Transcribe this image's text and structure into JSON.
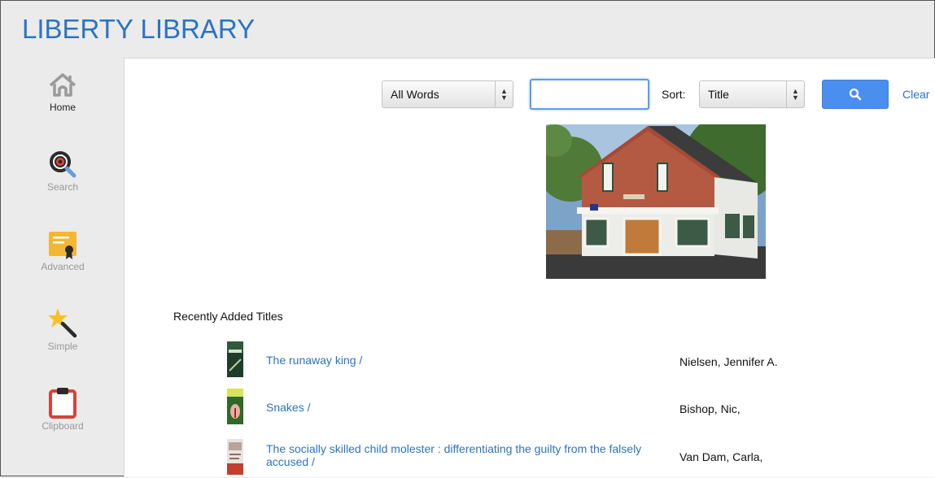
{
  "app": {
    "title": "LIBERTY LIBRARY"
  },
  "sidebar": {
    "items": [
      {
        "label": "Home",
        "icon": "home-icon",
        "active": true
      },
      {
        "label": "Search",
        "icon": "search-target-icon",
        "active": false
      },
      {
        "label": "Advanced",
        "icon": "certificate-icon",
        "active": false
      },
      {
        "label": "Simple",
        "icon": "magic-wand-icon",
        "active": false
      },
      {
        "label": "Clipboard",
        "icon": "clipboard-icon",
        "active": false
      }
    ]
  },
  "search": {
    "mode_value": "All Words",
    "query_value": "",
    "sort_label": "Sort:",
    "sort_value": "Title",
    "clear_label": "Clear",
    "button_icon": "magnifier-icon"
  },
  "recent": {
    "heading": "Recently Added Titles",
    "items": [
      {
        "title": "The runaway king /",
        "author": "Nielsen, Jennifer A.",
        "thumb_text": "RUNAWAY KING"
      },
      {
        "title": "Snakes /",
        "author": "Bishop, Nic,",
        "thumb_text": "SNAKES"
      },
      {
        "title": "The socially skilled child molester : differentiating the guilty from the falsely accused /",
        "author": "Van Dam, Carla,",
        "thumb_text": ""
      }
    ]
  },
  "colors": {
    "brand": "#2b73c2",
    "button": "#4a8ef0"
  }
}
